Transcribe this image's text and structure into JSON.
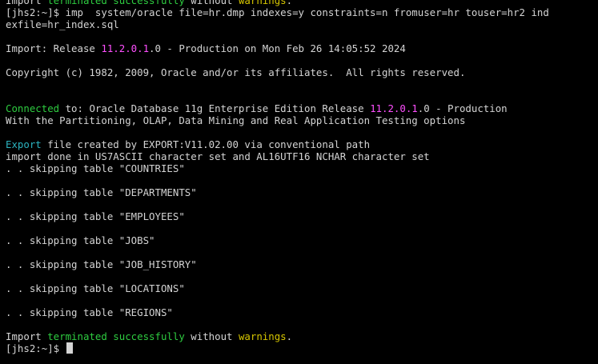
{
  "prev_line": {
    "t1": "Import ",
    "t2": "terminated",
    "t3": " ",
    "t4": "successfully",
    "t5": " without ",
    "t6": "warnings",
    "t7": "."
  },
  "command": {
    "prompt": "[jhs2:~]$ ",
    "text_line1": "imp  system/oracle file=hr.dmp indexes=y constraints=n fromuser=hr touser=hr2 ind",
    "text_line2": "exfile=hr_index.sql"
  },
  "release_line": {
    "t1": "Import: Release ",
    "version": "11.2.0.1",
    "t2": ".0 - Production on Mon Feb 26 14:05:52 2024"
  },
  "copyright": "Copyright (c) 1982, 2009, Oracle and/or its affiliates.  All rights reserved.",
  "connected_line": {
    "t1": "Connected",
    "t2": " to: Oracle Database 11g Enterprise Edition Release ",
    "version": "11.2.0.1",
    "t3": ".0 - Production"
  },
  "options_line": "With the Partitioning, OLAP, Data Mining and Real Application Testing options",
  "export_line": {
    "t1": "Export",
    "t2": " file created by EXPORT:V11.02.00 via conventional path"
  },
  "charset_line": "import done in US7ASCII character set and AL16UTF16 NCHAR character set",
  "skipping": [
    ". . skipping table \"COUNTRIES\"",
    ". . skipping table \"DEPARTMENTS\"",
    ". . skipping table \"EMPLOYEES\"",
    ". . skipping table \"JOBS\"",
    ". . skipping table \"JOB_HISTORY\"",
    ". . skipping table \"LOCATIONS\"",
    ". . skipping table \"REGIONS\""
  ],
  "final_line": {
    "t1": "Import ",
    "t2": "terminated",
    "t3": " ",
    "t4": "successfully",
    "t5": " without ",
    "t6": "warnings",
    "t7": "."
  },
  "final_prompt": "[jhs2:~]$ ",
  "colors": {
    "background": "#000000",
    "foreground": "#d4d4d4",
    "green": "#2ecc40",
    "yellow": "#d6c600",
    "cyan": "#2bb3c0",
    "magenta": "#ff4fff"
  }
}
